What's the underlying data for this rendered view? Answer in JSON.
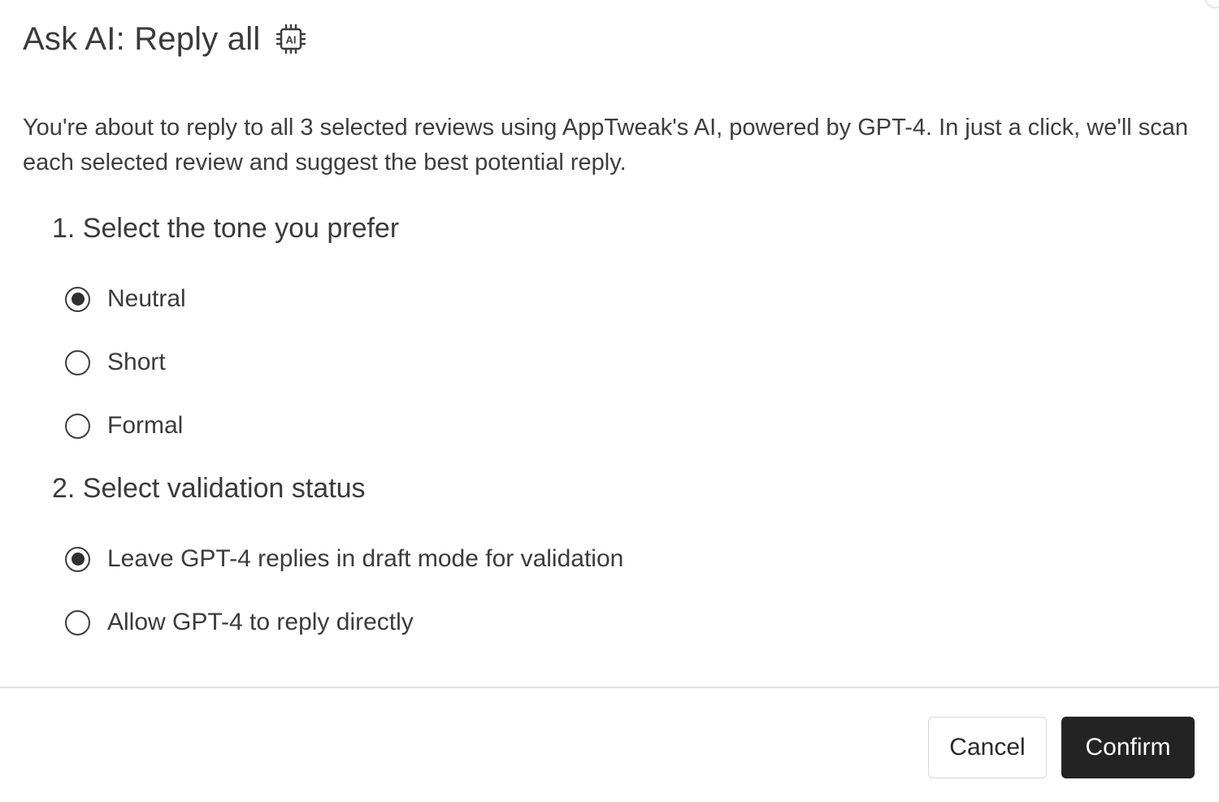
{
  "dialog": {
    "title": "Ask AI: Reply all",
    "ai_icon_text": "AI",
    "description": "You're about to reply to all 3 selected reviews using AppTweak's AI, powered by GPT-4. In just a click, we'll scan each selected review and suggest the best potential reply."
  },
  "tone_section": {
    "title": "1. Select the tone you prefer",
    "options": [
      {
        "label": "Neutral",
        "checked": true
      },
      {
        "label": "Short",
        "checked": false
      },
      {
        "label": "Formal",
        "checked": false
      }
    ]
  },
  "validation_section": {
    "title": "2. Select validation status",
    "options": [
      {
        "label": "Leave GPT-4 replies in draft mode for validation",
        "checked": true
      },
      {
        "label": "Allow GPT-4 to reply directly",
        "checked": false
      }
    ]
  },
  "footer": {
    "cancel_label": "Cancel",
    "confirm_label": "Confirm"
  },
  "colors": {
    "text": "#3b3b3b",
    "confirm_bg": "#232323",
    "divider": "#e3e3e3"
  },
  "icons": {
    "ai": "ai-chip-icon",
    "close": "close-icon"
  }
}
